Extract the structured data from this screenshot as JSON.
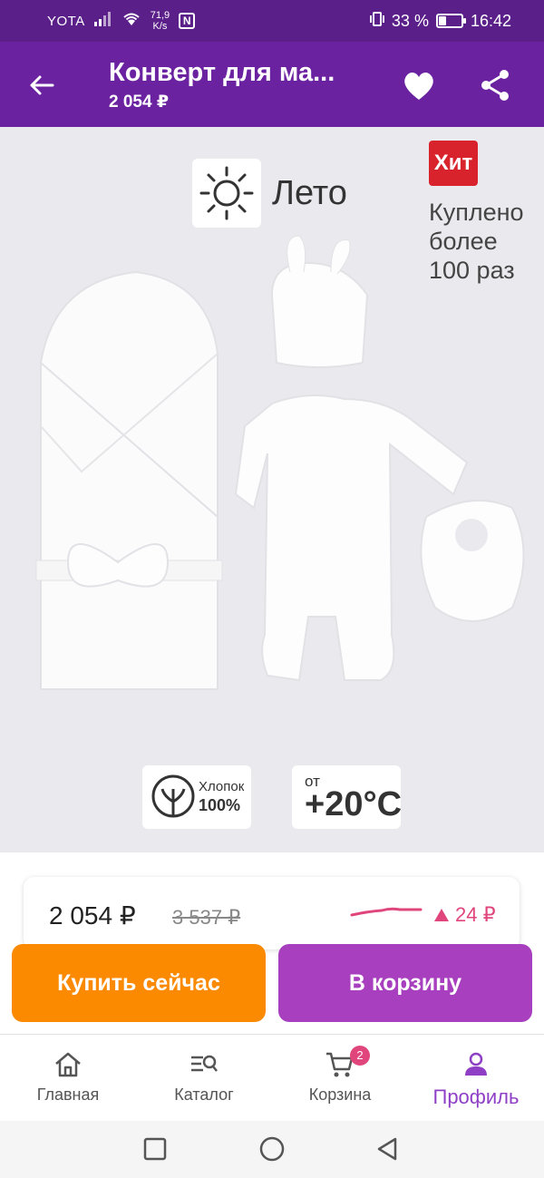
{
  "status_bar": {
    "carrier": "YOTA",
    "speed_value": "71,9",
    "speed_unit": "K/s",
    "nfc": "N",
    "battery": "33 %",
    "battery_level": 0.33,
    "time": "16:42"
  },
  "app_bar": {
    "title": "Конверт для ма...",
    "price": "2 054 ₽",
    "icons": [
      "arrow-left-icon",
      "heart-icon",
      "share-icon"
    ]
  },
  "product_image": {
    "season_label": "Лето",
    "hit_label": "Хит",
    "bought_text": "Куплено более 100 раз",
    "cotton_label": "Хлопок",
    "cotton_pct": "100%",
    "temp_from": "от",
    "temp_value": "+20°C"
  },
  "price_card": {
    "current": "2 054 ₽",
    "old": "3 537 ₽",
    "change": "24 ₽",
    "change_color": "#e0457b"
  },
  "actions": {
    "buy_now": "Купить сейчас",
    "add_to_cart": "В корзину"
  },
  "bottom_nav": {
    "items": [
      {
        "label": "Главная",
        "icon": "home-icon"
      },
      {
        "label": "Каталог",
        "icon": "catalog-search-icon"
      },
      {
        "label": "Корзина",
        "icon": "cart-icon",
        "badge": "2"
      },
      {
        "label": "Профиль",
        "icon": "profile-icon"
      }
    ],
    "active_color": "#8e3fc6"
  },
  "colors": {
    "status_bar": "#5b1f8a",
    "app_bar": "#6b22a0",
    "buy_now": "#fb8a00",
    "to_cart": "#a73fbe"
  }
}
